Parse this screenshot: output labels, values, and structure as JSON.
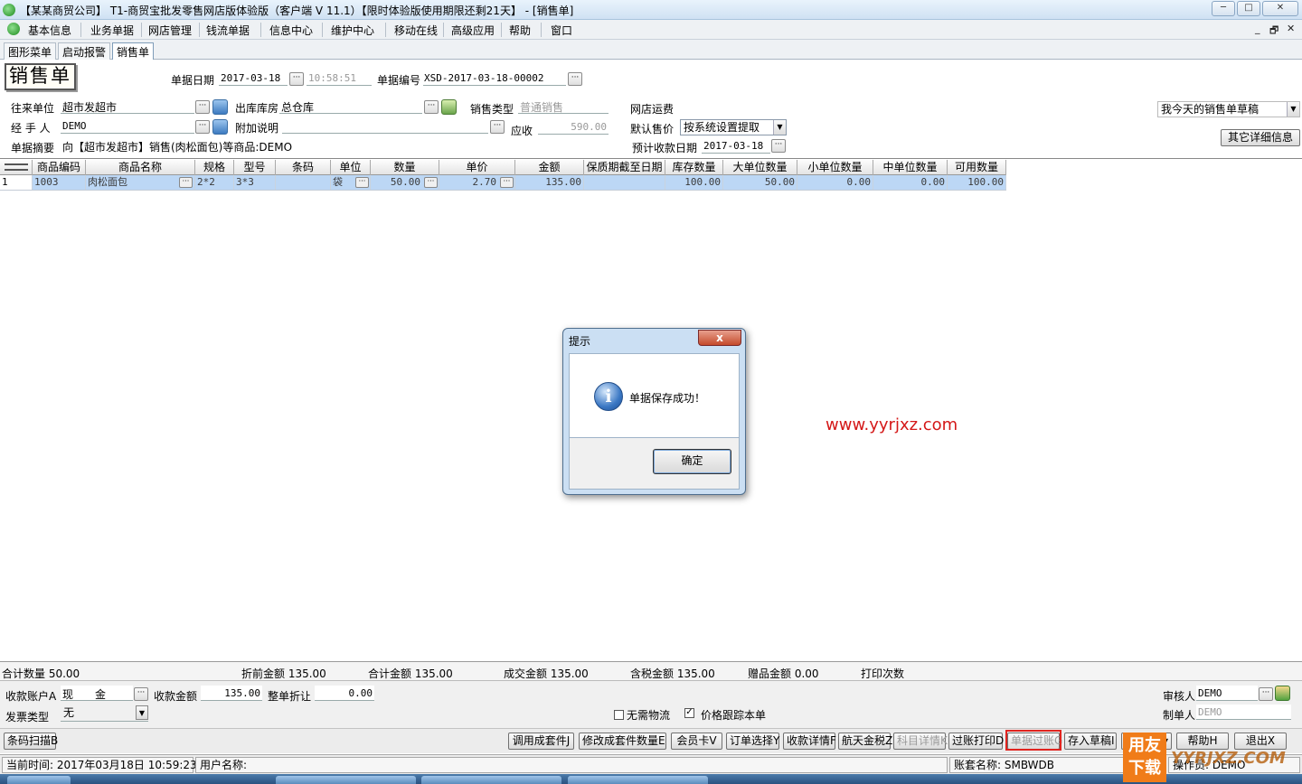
{
  "window": {
    "title": "【某某商贸公司】 T1-商贸宝批发零售网店版体验版（客户端 V 11.1）【限时体验版使用期限还剩21天】 - [销售单]",
    "min": "─",
    "max": "□",
    "close": "✕"
  },
  "menu": [
    "基本信息",
    "业务单据",
    "网店管理",
    "钱流单据",
    "信息中心",
    "维护中心",
    "移动在线",
    "高级应用",
    "帮助",
    "窗口"
  ],
  "mdi_controls": [
    "_",
    "🗗",
    "✕"
  ],
  "tabs": [
    "图形菜单",
    "启动报警",
    "销售单"
  ],
  "bill": {
    "title": "销售单",
    "date_label": "单据日期",
    "date": "2017-03-18",
    "time": "10:58:51",
    "no_label": "单据编号",
    "no": "XSD-2017-03-18-00002",
    "partner_label": "往来单位",
    "partner": "超市发超市",
    "warehouse_label": "出库库房",
    "warehouse": "总仓库",
    "sale_type_label": "销售类型",
    "sale_type": "普通销售",
    "shop_freight_label": "网店运费",
    "handler_label": "经 手 人",
    "handler": "DEMO",
    "note_label": "附加说明",
    "note": "",
    "receivable_label": "应收",
    "receivable": "590.00",
    "default_price_label": "默认售价",
    "default_price": "按系统设置提取",
    "summary_label": "单据摘要",
    "summary": "向【超市发超市】销售(肉松面包)等商品:DEMO",
    "expect_date_label": "预计收款日期",
    "expect_date": "2017-03-18",
    "drafts_combo": "我今天的销售单草稿",
    "other_info_button": "其它详细信息"
  },
  "grid": {
    "headers": [
      "",
      "商品编码",
      "商品名称",
      "规格",
      "型号",
      "条码",
      "单位",
      "数量",
      "单价",
      "金额",
      "保质期截至日期",
      "库存数量",
      "大单位数量",
      "小单位数量",
      "中单位数量",
      "可用数量"
    ],
    "rows": [
      [
        "1",
        "1003",
        "肉松面包",
        "2*2",
        "3*3",
        "",
        "袋",
        "50.00",
        "2.70",
        "135.00",
        "",
        "100.00",
        "50.00",
        "0.00",
        "0.00",
        "100.00"
      ]
    ]
  },
  "totals": {
    "qty": "合计数量 50.00",
    "pre_discount": "折前金额 135.00",
    "total": "合计金额 135.00",
    "deal": "成交金额 135.00",
    "tax_incl": "含税金额 135.00",
    "gift": "赠品金额 0.00",
    "print_count": "打印次数"
  },
  "payment": {
    "account_label": "收款账户A",
    "account": "现　　金",
    "amount_label": "收款金额",
    "amount": "135.00",
    "discount_label": "整单折让",
    "discount": "0.00",
    "invoice_label": "发票类型",
    "invoice": "无",
    "no_logistics": "无需物流",
    "price_track": "价格跟踪本单",
    "auditor_label": "审核人",
    "auditor": "DEMO",
    "maker_label": "制单人",
    "maker": "DEMO"
  },
  "buttons": {
    "barcode": "条码扫描B",
    "call_kit": "调用成套件J",
    "edit_kit": "修改成套件数量E",
    "member": "会员卡V",
    "order_select": "订单选择Y",
    "receipt_detail": "收款详情F",
    "aisino_tax": "航天金税Z",
    "subject_detail": "科目详情K",
    "post_print": "过账打印D",
    "post": "单据过账G",
    "save_draft": "存入草稿I",
    "help": "帮助H",
    "exit": "退出X"
  },
  "status": {
    "time": "当前时间: 2017年03月18日  10:59:23",
    "user": "用户名称:",
    "account_set": "账套名称: SMBWDB",
    "operator": "操作员: DEMO"
  },
  "dialog": {
    "title": "提示",
    "close": "x",
    "icon": "i",
    "message": "单据保存成功！",
    "ok": "确定"
  },
  "overlay": {
    "watermark": "www.yyrjxz.com",
    "brand_line1": "用友",
    "brand_line2": "下载",
    "brand_text": "YYRJXZ.COM"
  },
  "colors": {
    "selected_row": "#bcd7f5",
    "highlight": "#e0241f",
    "watermark": "#d41818"
  },
  "icons": [
    "app-icon",
    "ellipsis-icon",
    "person-card-icon",
    "warehouse-icon",
    "dropdown-arrow-icon",
    "info-icon",
    "close-icon",
    "checkbox-checked-icon"
  ]
}
